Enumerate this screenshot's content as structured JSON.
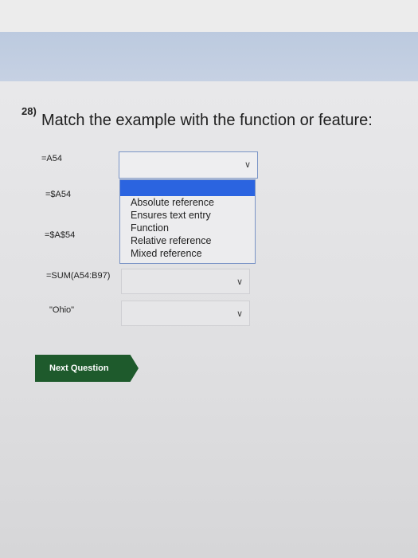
{
  "question": {
    "number": "28)",
    "text": "Match the example with the function or feature:"
  },
  "examples": [
    "=A54",
    "=$A54",
    "=$A$54",
    "=SUM(A54:B97)",
    "\"Ohio\""
  ],
  "dropdown": {
    "options": [
      "Absolute reference",
      "Ensures text entry",
      "Function",
      "Relative reference",
      "Mixed reference"
    ]
  },
  "buttons": {
    "next_label": "Next Question"
  },
  "colors": {
    "highlight": "#2b64e0",
    "next_button": "#1e5a2c"
  }
}
